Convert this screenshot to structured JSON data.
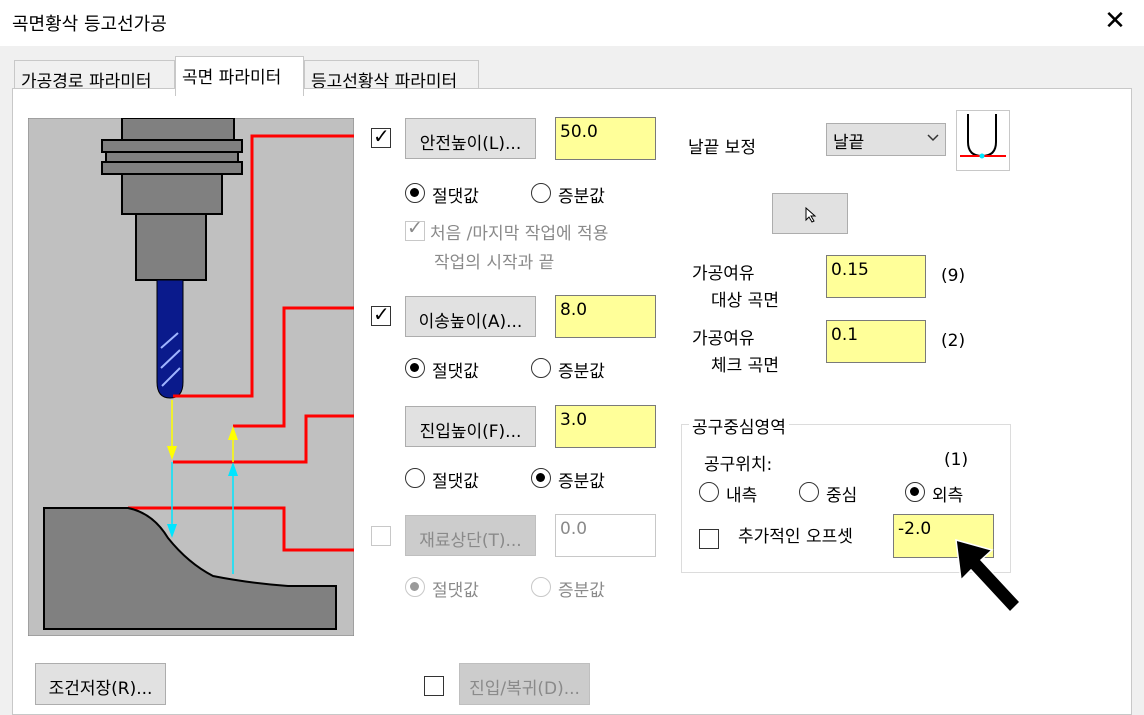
{
  "window": {
    "title": "곡면황삭 등고선가공",
    "close_glyph": "✕"
  },
  "tabs": [
    {
      "label": "가공경로 파라미터",
      "active": false
    },
    {
      "label": "곡면 파라미터",
      "active": true
    },
    {
      "label": "등고선황삭 파라미터",
      "active": false
    }
  ],
  "heights": {
    "clearance": {
      "button": "안전높이(L)...",
      "value": "50.0",
      "checked": true,
      "absolute": "절댓값",
      "incremental": "증분값",
      "mode": "absolute"
    },
    "first_last": {
      "label": "처음 /마지막 작업에 적용",
      "sub": "작업의 시작과 끝",
      "checked": true
    },
    "retract": {
      "button": "이송높이(A)...",
      "value": "8.0",
      "checked": true,
      "absolute": "절댓값",
      "incremental": "증분값",
      "mode": "absolute"
    },
    "feed_plane": {
      "button": "진입높이(F)...",
      "value": "3.0",
      "absolute": "절댓값",
      "incremental": "증분값",
      "mode": "incremental"
    },
    "top_of_stock": {
      "button": "재료상단(T)...",
      "value": "0.0",
      "checked": false,
      "absolute": "절댓값",
      "incremental": "증분값",
      "mode": "absolute"
    }
  },
  "tip_comp": {
    "label": "날끝 보정",
    "value": "날끝"
  },
  "stock_to_leave": {
    "drive": {
      "label1": "가공여유",
      "label2": "대상 곡면",
      "value": "0.15",
      "count": "(9)"
    },
    "check": {
      "label1": "가공여유",
      "label2": "체크 곡면",
      "value": "0.1",
      "count": "(2)"
    }
  },
  "tool_containment": {
    "title": "공구중심영역",
    "position_label": "공구위치:",
    "position_count": "(1)",
    "inside": "내측",
    "center": "중심",
    "outside": "외측",
    "selected": "outside",
    "offset_label": "추가적인 오프셋",
    "offset_value": "-2.0",
    "offset_checked": false
  },
  "footer": {
    "save_button": "조건저장(R)...",
    "entry_exit_button": "진입/복귀(D)...",
    "entry_exit_checked": false
  },
  "colors": {
    "field_yellow": "#ffff99",
    "height_line_red": "#ff0000",
    "arrow_yellow": "#ffff00",
    "arrow_cyan": "#00e5ff",
    "tool_blue": "#0a1a8c"
  }
}
